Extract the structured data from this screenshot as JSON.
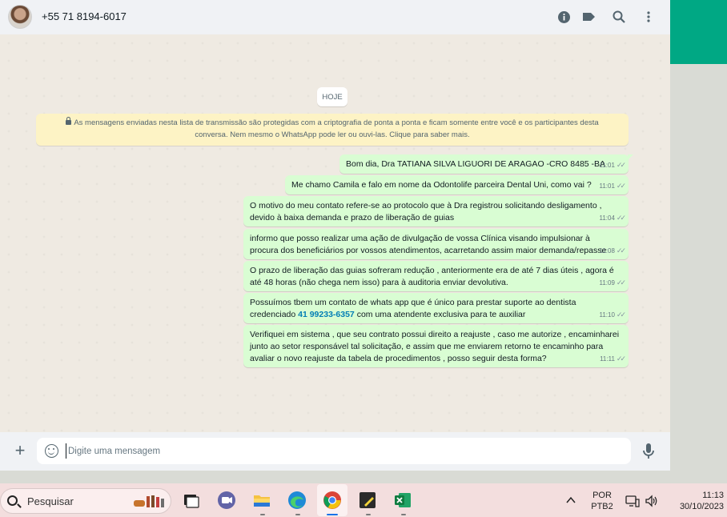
{
  "header": {
    "contact": "+55 71 8194-6017",
    "icons": [
      "info-icon",
      "label-icon",
      "search-icon",
      "menu-dots-icon"
    ]
  },
  "chat": {
    "date_chip": "HOJE",
    "notice": "As mensagens enviadas nesta lista de transmissão são protegidas com a criptografia de ponta a ponta e ficam somente entre você e os participantes desta conversa. Nem mesmo o WhatsApp pode ler ou ouvi-las. Clique para saber mais.",
    "messages": [
      {
        "text": "Bom dia, Dra TATIANA SILVA LIGUORI DE ARAGAO -CRO 8485 -BA",
        "time": "11:01"
      },
      {
        "text": "Me chamo Camila e falo em nome da Odontolife parceira Dental Uni, como vai ?",
        "time": "11:01"
      },
      {
        "text": "O motivo do meu contato refere-se ao protocolo que à Dra registrou solicitando desligamento , devido à baixa demanda e prazo de liberação de guias",
        "time": "11:04"
      },
      {
        "text": "informo que posso realizar uma ação de divulgação de vossa Clínica visando impulsionar à procura dos beneficiários por vossos atendimentos, acarretando assim maior demanda/repasse",
        "time": "11:08"
      },
      {
        "text": "O prazo de liberação das guias sofreram redução , anteriormente era de até 7 dias úteis , agora é até 48 horas (não chega nem isso) para à auditoria enviar devolutiva.",
        "time": "11:09"
      },
      {
        "text_before": "Possuímos tbem um contato de whats app que é único para prestar suporte ao dentista credenciado ",
        "phone": "41 99233-6357",
        "text_after": " com uma atendente exclusiva para te auxiliar",
        "time": "11:10"
      },
      {
        "text": "Verifiquei em sistema , que seu contrato possui direito a reajuste , caso me autorize , encaminharei junto ao setor responsável tal solicitação, e assim que me enviarem retorno te encaminho para avaliar o novo reajuste da tabela de procedimentos , posso seguir desta forma?",
        "time": "11:11"
      }
    ]
  },
  "composer": {
    "placeholder": "Digite uma mensagem"
  },
  "taskbar": {
    "search_placeholder": "Pesquisar",
    "language_top": "POR",
    "language_bottom": "PTB2",
    "time": "11:13",
    "date": "30/10/2023"
  },
  "colors": {
    "outgoing_bubble": "#d9fdd3",
    "chat_bg": "#efeae2",
    "accent": "#00a884",
    "link": "#027eb5"
  }
}
